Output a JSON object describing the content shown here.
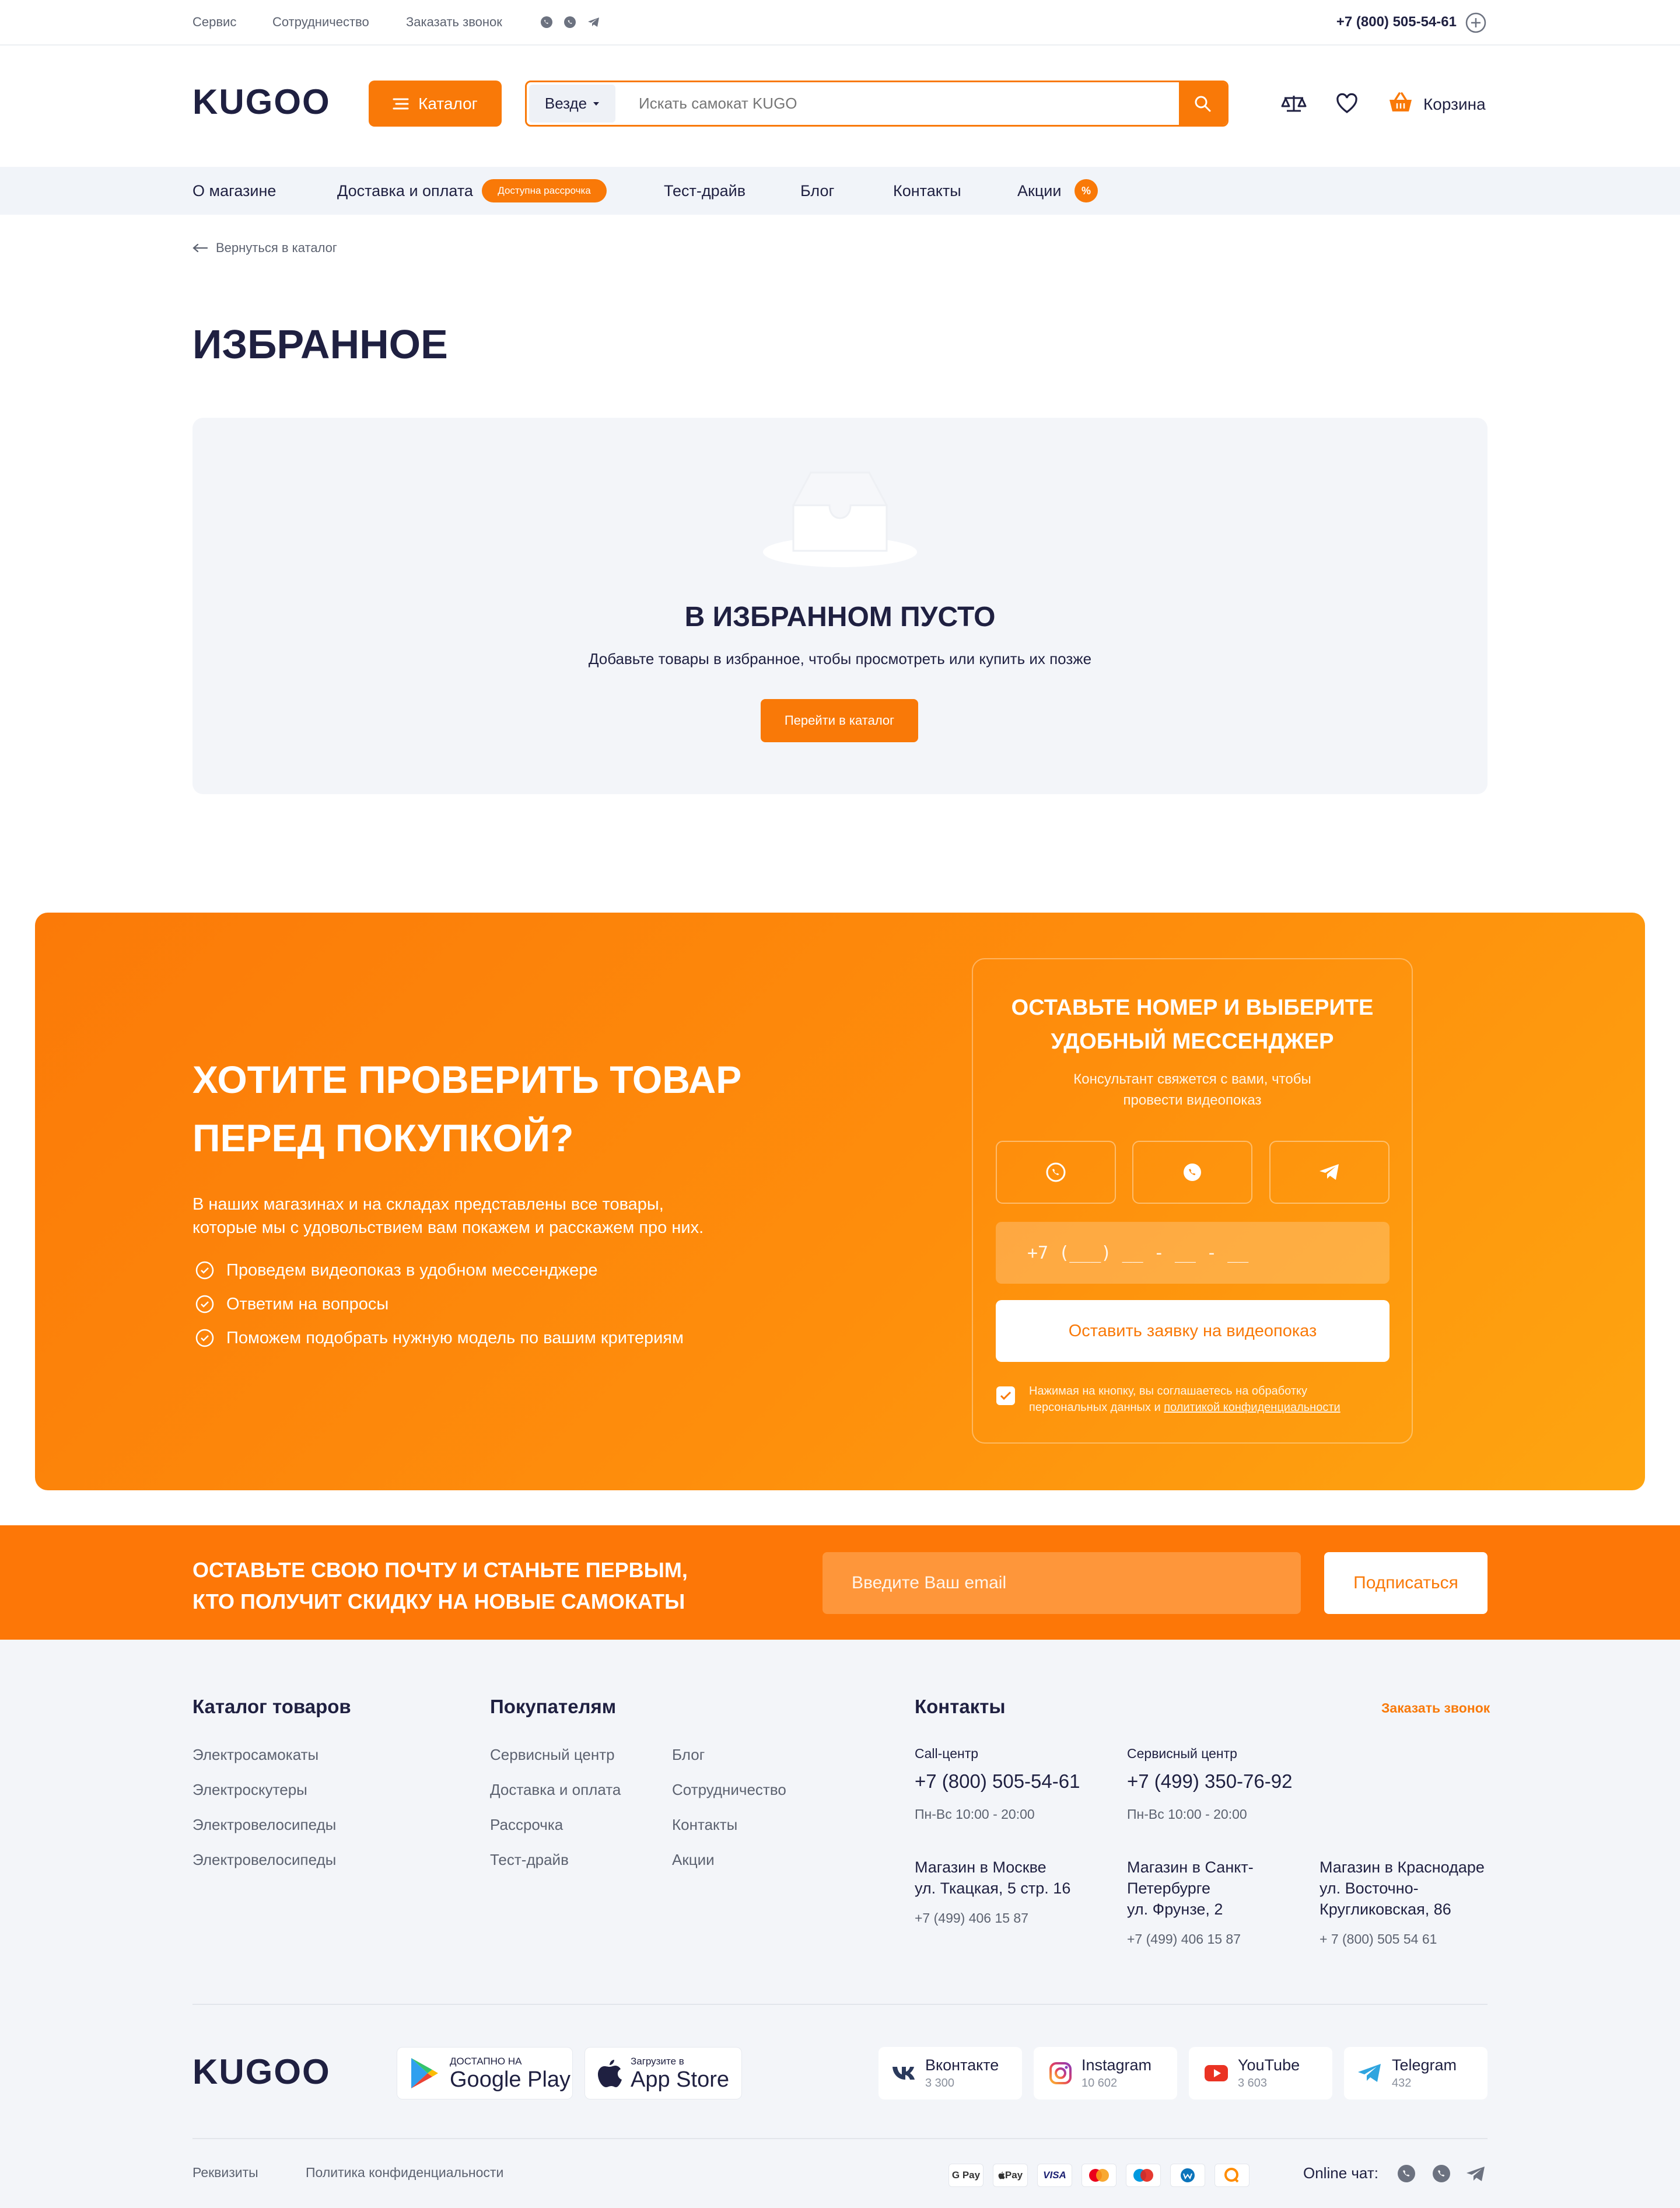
{
  "topbar": {
    "links": [
      "Сервис",
      "Сотрудничество",
      "Заказать звонок"
    ],
    "phone": "+7 (800) 505-54-61"
  },
  "header": {
    "logo": "KUGOO",
    "catalog_label": "Каталог",
    "search_scope": "Везде",
    "search_placeholder": "Искать самокат KUGO",
    "cart_label": "Корзина"
  },
  "nav": {
    "items": [
      "О магазине",
      "Доставка и оплата",
      "Тест-драйв",
      "Блог",
      "Контакты",
      "Акции"
    ],
    "installment_badge": "Доступна рассрочка",
    "promo_badge": "%"
  },
  "breadcrumb": {
    "back_label": "Вернуться в каталог"
  },
  "page": {
    "title": "ИЗБРАННОЕ"
  },
  "empty": {
    "title": "В ИЗБРАННОМ ПУСТО",
    "text": "Добавьте товары в избранное, чтобы просмотреть или купить их позже",
    "button": "Перейти в каталог"
  },
  "promo": {
    "title_line1": "ХОТИТЕ ПРОВЕРИТЬ ТОВАР",
    "title_line2": "ПЕРЕД ПОКУПКОЙ?",
    "text_line1": "В наших магазинах и на складах представлены все товары,",
    "text_line2": "которые мы с удовольствием вам покажем и расскажем про них.",
    "bullets": [
      "Проведем видеопоказ в удобном мессенджере",
      "Ответим на вопросы",
      "Поможем подобрать нужную модель по вашим критериям"
    ],
    "form": {
      "title_line1": "ОСТАВЬТЕ НОМЕР И ВЫБЕРИТЕ",
      "title_line2": "УДОБНЫЙ МЕССЕНДЖЕР",
      "subtitle_line1": "Консультант свяжется с вами, чтобы",
      "subtitle_line2": "провести видеопоказ",
      "phone_placeholder": "+7  (___)  __  -  __  -  __",
      "submit": "Оставить заявку на видеопоказ",
      "consent_line1": "Нажимая на кнопку, вы соглашаетесь на обработку",
      "consent_line2_prefix": "персональных данных и ",
      "consent_link": "политикой конфиденциальности"
    }
  },
  "subscribe": {
    "title_line1": "ОСТАВЬТЕ СВОЮ ПОЧТУ И СТАНЬТЕ ПЕРВЫМ,",
    "title_line2": "КТО ПОЛУЧИТ СКИДКУ НА НОВЫЕ САМОКАТЫ",
    "email_placeholder": "Введите Ваш email",
    "button": "Подписаться"
  },
  "footer": {
    "catalog_title": "Каталог товаров",
    "catalog_links": [
      "Электросамокаты",
      "Электроскутеры",
      "Электровелосипеды",
      "Электровелосипеды"
    ],
    "buyers_title": "Покупателям",
    "buyers_col1": [
      "Сервисный центр",
      "Доставка и оплата",
      "Рассрочка",
      "Тест-драйв"
    ],
    "buyers_col2": [
      "Блог",
      "Сотрудничество",
      "Контакты",
      "Акции"
    ],
    "contacts_title": "Контакты",
    "order_call": "Заказать звонок",
    "callcenter_label": "Call-центр",
    "callcenter_phone": "+7 (800) 505-54-61",
    "callcenter_hours": "Пн-Вс 10:00 - 20:00",
    "service_label": "Сервисный центр",
    "service_phone": "+7 (499) 350-76-92",
    "service_hours": "Пн-Вс 10:00 - 20:00",
    "stores": [
      {
        "lines": [
          "Магазин в Москве",
          "ул. Ткацкая, 5 стр. 16"
        ],
        "phone": "+7 (499) 406 15 87"
      },
      {
        "lines": [
          "Магазин в Санкт-",
          "Петербурге",
          "ул. Фрунзе, 2"
        ],
        "phone": "+7 (499) 406 15 87"
      },
      {
        "lines": [
          "Магазин в Краснодаре",
          "ул. Восточно-",
          "Кругликовская, 86"
        ],
        "phone": "+ 7 (800) 505 54 61"
      }
    ],
    "logo": "KUGOO",
    "google_small": "ДОСТАПНО НА",
    "google_big": "Google Play",
    "apple_small": "Загрузите в",
    "apple_big": "App Store",
    "socials": [
      {
        "name": "Вконтакте",
        "count": "3 300"
      },
      {
        "name": "Instagram",
        "count": "10 602"
      },
      {
        "name": "YouTube",
        "count": "3 603"
      },
      {
        "name": "Telegram",
        "count": "432"
      }
    ],
    "legal_links": [
      "Реквизиты",
      "Политика конфиденциальности"
    ],
    "payments": [
      "G Pay",
      "Pay",
      "VISA"
    ],
    "online_chat": "Online чат:"
  },
  "colors": {
    "accent": "#f97908",
    "dark": "#1f2041",
    "muted": "#5c6270",
    "light_bg": "#f3f5f9"
  }
}
